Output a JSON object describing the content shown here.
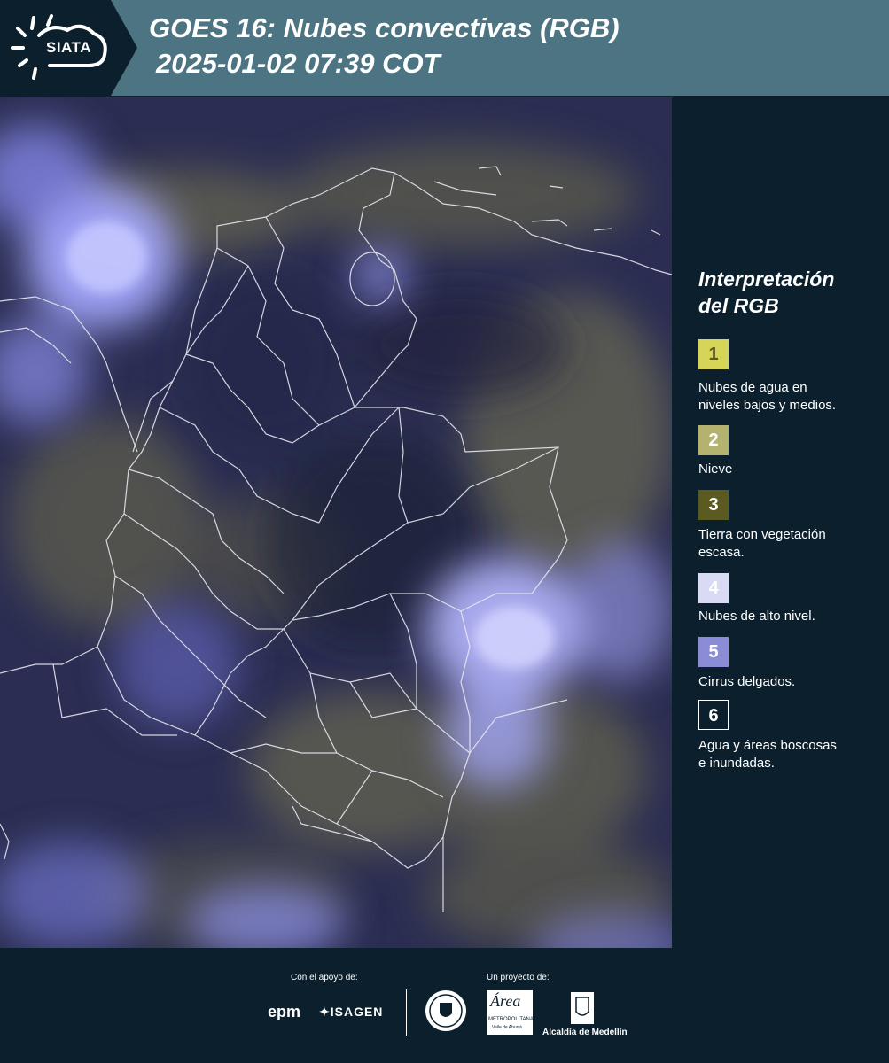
{
  "header": {
    "logo_text": "SIATA",
    "title_line1": "GOES 16: Nubes convectivas (RGB)",
    "title_line2": "2025-01-02 07:39 COT"
  },
  "legend": {
    "title_line1": "Interpretación",
    "title_line2": "del RGB",
    "items": [
      {
        "num": "1",
        "color": "#d7d45a",
        "text_color": "#5c5a1a",
        "label_lines": [
          "Nubes de agua en",
          "niveles bajos y medios."
        ]
      },
      {
        "num": "2",
        "color": "#b4b26f",
        "text_color": "#ffffff",
        "label_lines": [
          "Nieve",
          ""
        ]
      },
      {
        "num": "3",
        "color": "#5b5a20",
        "text_color": "#ffffff",
        "label_lines": [
          "Tierra con vegetación",
          "escasa."
        ]
      },
      {
        "num": "4",
        "color": "#d9daf3",
        "text_color": "#ffffff",
        "label_lines": [
          "Nubes de alto nivel.",
          ""
        ]
      },
      {
        "num": "5",
        "color": "#8a8cd6",
        "text_color": "#ffffff",
        "label_lines": [
          "Cirrus delgados.",
          ""
        ]
      },
      {
        "num": "6",
        "color": "#0b1f2c",
        "text_color": "#ffffff",
        "label_lines": [
          "Agua y áreas boscosas",
          "e inundadas."
        ]
      }
    ]
  },
  "footer": {
    "support_caption": "Con el apoyo de:",
    "project_caption": "Un proyecto de:",
    "logo_epm": "epm",
    "logo_isagen": "ISAGEN",
    "logo_area_line1": "Área",
    "logo_area_line2": "METROPOLITANA",
    "logo_area_line3": "Valle de Aburrá",
    "logo_alcaldia": "Alcaldía de Medellín"
  },
  "colors": {
    "header_bg": "#4d7482",
    "panel_bg": "#0b1f2c",
    "map_base": "#2a2f57",
    "cloud_high": "#9a9cf5",
    "cloud_low": "#8b8a4a"
  }
}
